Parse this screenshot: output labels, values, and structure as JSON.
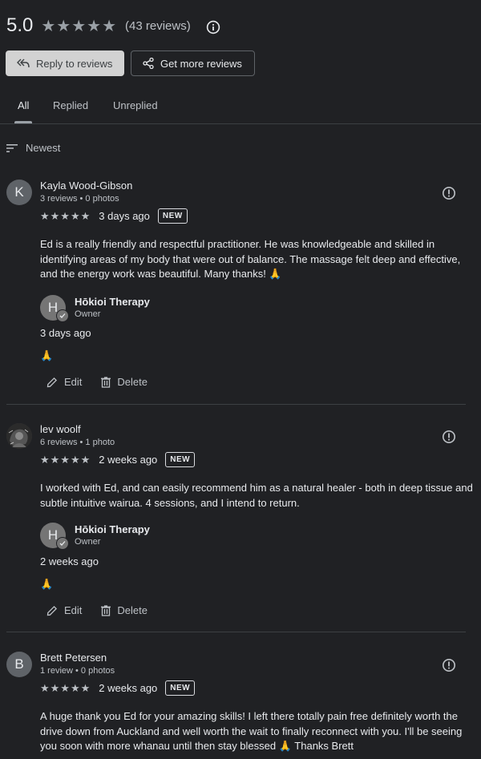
{
  "summary": {
    "rating": "5.0",
    "stars": "★★★★★",
    "count": "(43 reviews)"
  },
  "buttons": {
    "reply": "Reply to reviews",
    "more": "Get more reviews"
  },
  "tabs": [
    {
      "label": "All"
    },
    {
      "label": "Replied"
    },
    {
      "label": "Unreplied"
    }
  ],
  "sort": {
    "label": "Newest"
  },
  "reviews": [
    {
      "initial": "K",
      "name": "Kayla Wood-Gibson",
      "meta": "3 reviews • 0 photos",
      "stars": "★★★★★",
      "date": "3 days ago",
      "badge": "NEW",
      "text": "Ed is a really friendly and respectful practitioner. He was knowledgeable and skilled in identifying areas of my body that were out of balance. The massage felt deep and effective, and the energy work was beautiful. Many thanks! 🙏",
      "reply": {
        "initial": "H",
        "owner": "Hōkioi Therapy",
        "role": "Owner",
        "date": "3 days ago",
        "text": "🙏"
      },
      "edit": "Edit",
      "delete": "Delete"
    },
    {
      "initial": "",
      "name": "lev woolf",
      "meta": "6 reviews • 1 photo",
      "stars": "★★★★★",
      "date": "2 weeks ago",
      "badge": "NEW",
      "text": "I worked with Ed, and can easily recommend him as a natural healer - both in deep tissue and subtle intuitive wairua. 4 sessions, and I intend to return.",
      "reply": {
        "initial": "H",
        "owner": "Hōkioi Therapy",
        "role": "Owner",
        "date": "2 weeks ago",
        "text": "🙏"
      },
      "edit": "Edit",
      "delete": "Delete"
    },
    {
      "initial": "B",
      "name": "Brett Petersen",
      "meta": "1 review • 0 photos",
      "stars": "★★★★★",
      "date": "2 weeks ago",
      "badge": "NEW",
      "text": "A huge thank you Ed for your amazing skills! I left there totally pain free definitely worth the drive down from Auckland and well worth the wait to finally reconnect with you. I'll be seeing you soon with more whanau until then stay blessed 🙏 Thanks Brett"
    }
  ]
}
